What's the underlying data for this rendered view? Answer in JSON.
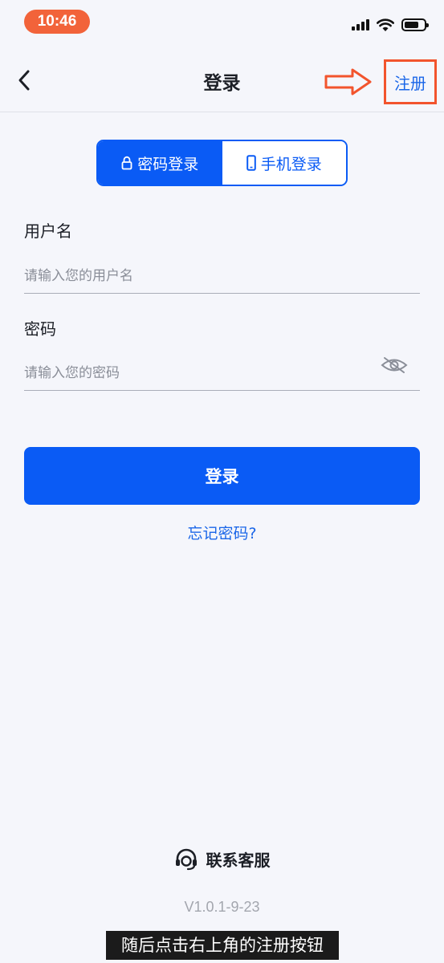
{
  "status_bar": {
    "time": "10:46",
    "time_pill_color": "#f2633a"
  },
  "header": {
    "title": "登录",
    "register_label": "注册",
    "annotation_color": "#f2542d"
  },
  "tabs": [
    {
      "label": "密码登录",
      "icon": "lock-icon",
      "active": true
    },
    {
      "label": "手机登录",
      "icon": "phone-icon",
      "active": false
    }
  ],
  "form": {
    "username_label": "用户名",
    "username_placeholder": "请输入您的用户名",
    "password_label": "密码",
    "password_placeholder": "请输入您的密码",
    "password_visibility_icon": "eye-off-icon",
    "login_button": "登录",
    "forgot_password": "忘记密码?"
  },
  "footer": {
    "support_icon": "headset-icon",
    "support_label": "联系客服",
    "version": "V1.0.1-9-23"
  },
  "subtitle": "随后点击右上角的注册按钮",
  "colors": {
    "primary": "#0a5bf5",
    "link": "#1a66e8",
    "background": "#f5f6fb"
  }
}
